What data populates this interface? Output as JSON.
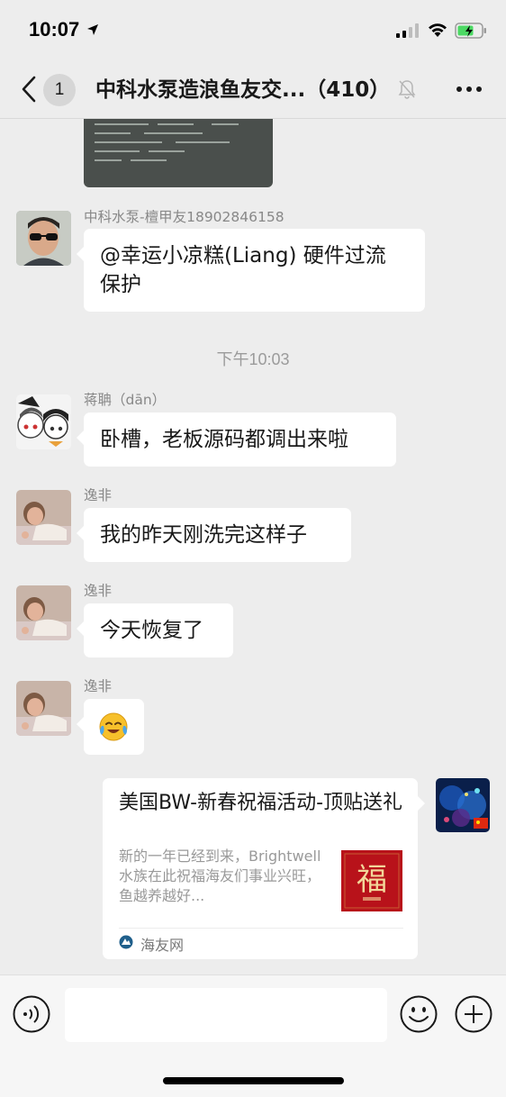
{
  "status_bar": {
    "time": "10:07"
  },
  "nav": {
    "unread_count": "1",
    "title": "中科水泵造浪鱼友交...（410）"
  },
  "messages": [
    {
      "sender": "中科水泵-檀甲友18902846158",
      "text_line1": "@幸运小凉糕(Liang) 硬件过流",
      "text_line2": "保护"
    },
    {
      "sender": "蒋聃（dān）",
      "text": "卧槽，老板源码都调出来啦"
    },
    {
      "sender": "逸非",
      "text": "我的昨天刚洗完这样子"
    },
    {
      "sender": "逸非",
      "text": "今天恢复了"
    },
    {
      "sender": "逸非",
      "emoji": "😭"
    }
  ],
  "time_divider": "下午10:03",
  "link_card": {
    "title": "美国BW-新春祝福活动-顶贴送礼",
    "description": "新的一年已经到来，Brightwell水族在此祝福海友们事业兴旺，鱼越养越好...",
    "thumb_char": "福",
    "source": "海友网"
  },
  "input": {
    "placeholder": ""
  },
  "colors": {
    "background": "#ededed",
    "bubble": "#ffffff",
    "accent_red": "#b8121a"
  }
}
